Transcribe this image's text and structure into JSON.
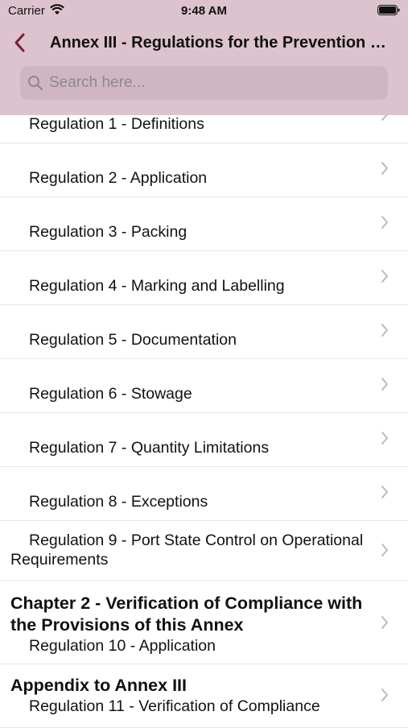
{
  "status_bar": {
    "carrier": "Carrier",
    "time": "9:48 AM"
  },
  "nav": {
    "title": "Annex III - Regulations for the Prevention of Pollution by Harmful Substances Carried by Sea in Packaged Form"
  },
  "search": {
    "placeholder": "Search here..."
  },
  "list": {
    "regulations_1_8": [
      "Regulation 1 - Definitions",
      "Regulation 2 - Application",
      "Regulation 3 - Packing",
      "Regulation 4 - Marking and Labelling",
      "Regulation 5 - Documentation",
      "Regulation 6 - Stowage",
      "Regulation 7 - Quantity Limitations",
      "Regulation 8 - Exceptions"
    ],
    "regulation_9": "Regulation 9 - Port State Control on Operational Requirements",
    "chapter2": {
      "heading": "Chapter 2 - Verification of Compliance with the Provisions of this Annex",
      "item": "Regulation 10 - Application"
    },
    "appendix": {
      "heading": "Appendix to Annex III",
      "item": "Regulation 11 - Verification of Compliance"
    }
  }
}
